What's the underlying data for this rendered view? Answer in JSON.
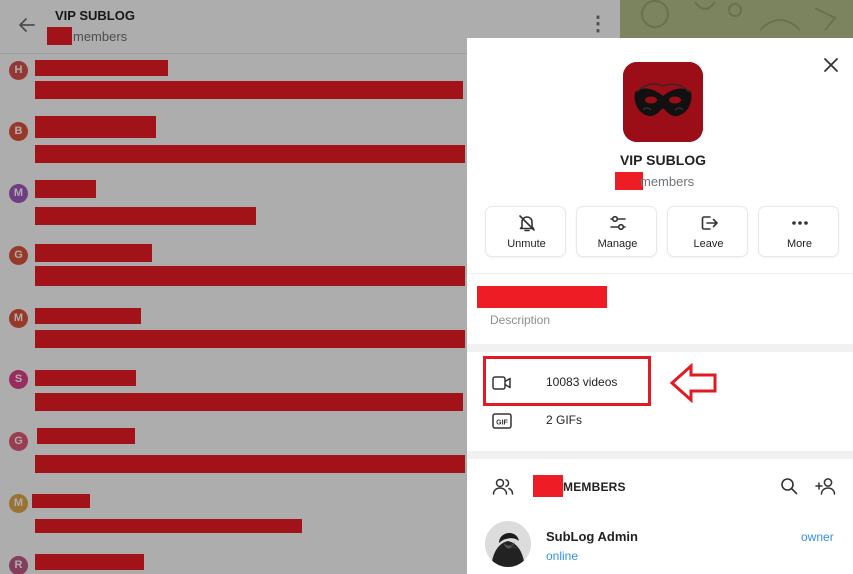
{
  "chat": {
    "title": "VIP SUBLOG",
    "members_suffix": "members",
    "messages": [
      {
        "initial": "H",
        "color": "#d9534f"
      },
      {
        "initial": "B",
        "color": "#e0533b"
      },
      {
        "initial": "M",
        "color": "#a35bc1"
      },
      {
        "initial": "G",
        "color": "#e0533b"
      },
      {
        "initial": "M",
        "color": "#e0533b"
      },
      {
        "initial": "S",
        "color": "#e0418a"
      },
      {
        "initial": "G",
        "color": "#e05a7a"
      },
      {
        "initial": "M",
        "color": "#e3a94a"
      },
      {
        "initial": "R",
        "color": "#c25a8a"
      }
    ]
  },
  "panel": {
    "group_name": "VIP SUBLOG",
    "members_suffix": "members",
    "actions": [
      {
        "label": "Unmute",
        "icon": "bell-off-icon"
      },
      {
        "label": "Manage",
        "icon": "sliders-icon"
      },
      {
        "label": "Leave",
        "icon": "leave-icon"
      },
      {
        "label": "More",
        "icon": "more-dots-icon"
      }
    ],
    "description_label": "Description",
    "media": {
      "videos": "10083 videos",
      "gifs": "2 GIFs"
    },
    "members_title_suffix": "MEMBERS",
    "member": {
      "name": "SubLog Admin",
      "status": "online",
      "role": "owner"
    }
  },
  "colors": {
    "redaction": "#ee1c25",
    "accent": "#3390ec",
    "highlight": "#e11a23",
    "group_avatar_bg": "#9b0d17"
  }
}
